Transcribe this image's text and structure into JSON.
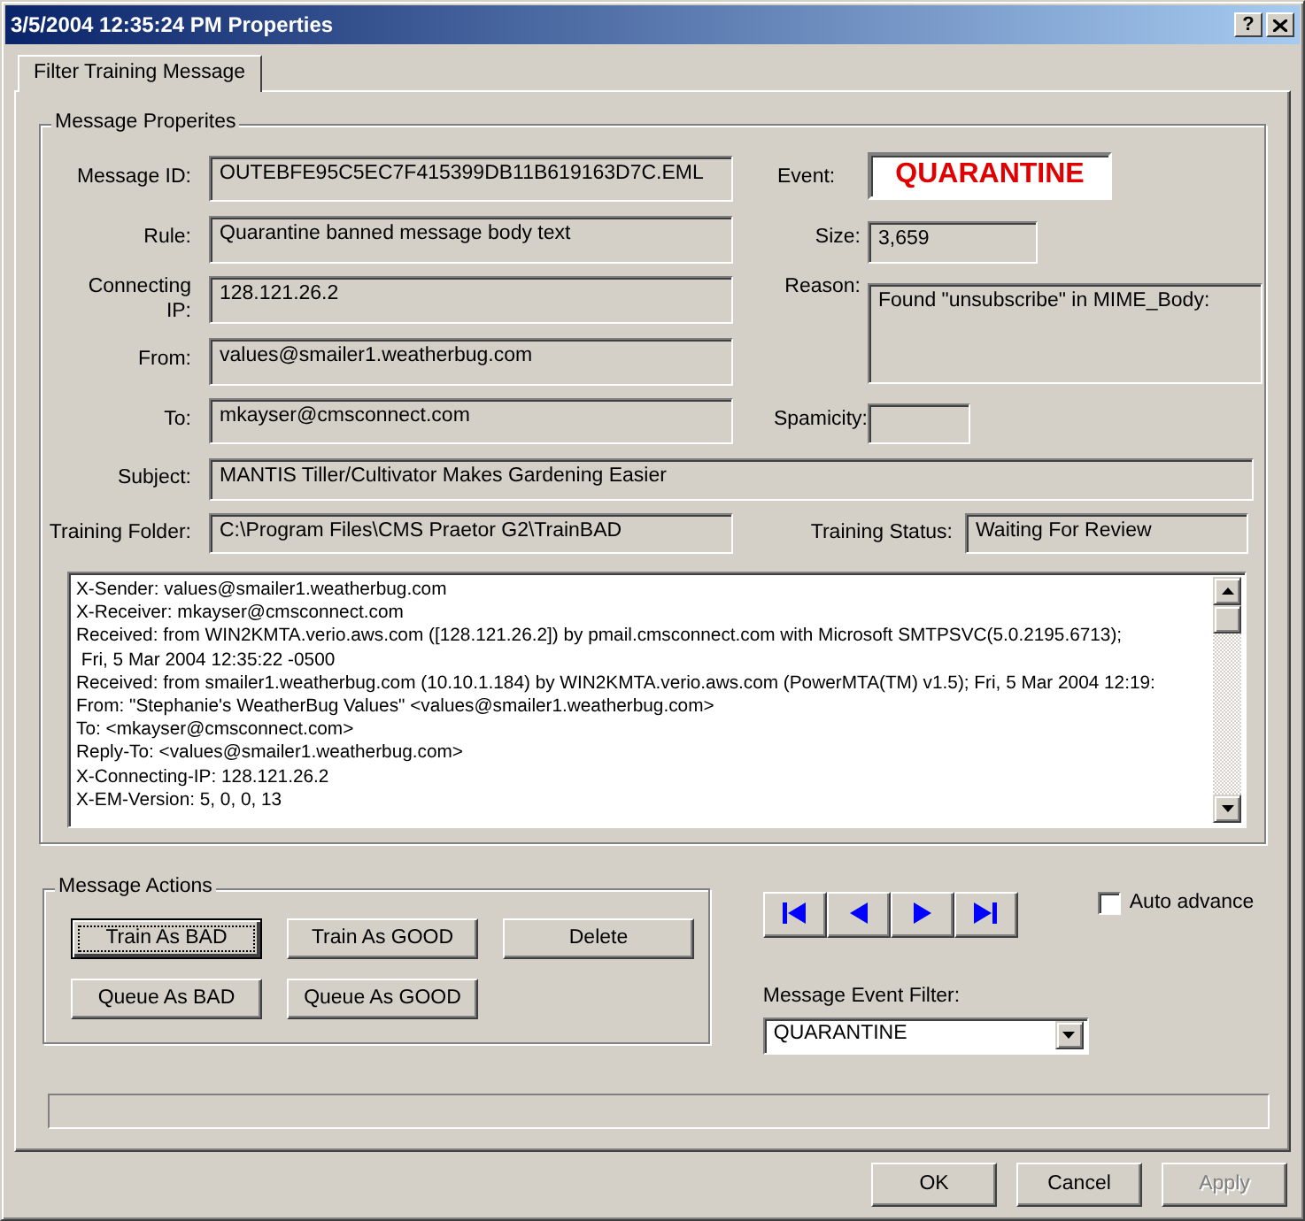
{
  "window": {
    "title": "3/5/2004 12:35:24 PM Properties",
    "help_label": "?"
  },
  "tabs": [
    {
      "label": "Filter Training Message",
      "selected": true
    }
  ],
  "message_properties": {
    "title": "Message Properites",
    "message_id": {
      "label": "Message ID:",
      "value": "OUTEBFE95C5EC7F415399DB11B619163D7C.EML"
    },
    "rule": {
      "label": "Rule:",
      "value": "Quarantine banned message body text"
    },
    "connecting_ip": {
      "label": "Connecting IP:",
      "value": "128.121.26.2"
    },
    "from": {
      "label": "From:",
      "value": "values@smailer1.weatherbug.com"
    },
    "to": {
      "label": "To:",
      "value": "mkayser@cmsconnect.com"
    },
    "subject": {
      "label": "Subject:",
      "value": "MANTIS Tiller/Cultivator Makes Gardening Easier"
    },
    "training_folder": {
      "label": "Training Folder:",
      "value": "C:\\Program Files\\CMS Praetor G2\\TrainBAD"
    },
    "event": {
      "label": "Event:",
      "value": "QUARANTINE"
    },
    "size": {
      "label": "Size:",
      "value": "3,659"
    },
    "reason": {
      "label": "Reason:",
      "value": "Found \"unsubscribe\" in MIME_Body:"
    },
    "spamicity": {
      "label": "Spamicity:"
    },
    "training_status": {
      "label": "Training Status:",
      "value": "Waiting For Review"
    },
    "headers": [
      "X-Sender: values@smailer1.weatherbug.com",
      "X-Receiver: mkayser@cmsconnect.com",
      "Received: from WIN2KMTA.verio.aws.com ([128.121.26.2]) by pmail.cmsconnect.com with Microsoft SMTPSVC(5.0.2195.6713);",
      " Fri, 5 Mar 2004 12:35:22 -0500",
      "Received: from smailer1.weatherbug.com (10.10.1.184) by WIN2KMTA.verio.aws.com (PowerMTA(TM) v1.5); Fri, 5 Mar 2004 12:19:",
      "From: \"Stephanie's WeatherBug Values\" <values@smailer1.weatherbug.com>",
      "To: <mkayser@cmsconnect.com>",
      "Reply-To: <values@smailer1.weatherbug.com>",
      "X-Connecting-IP: 128.121.26.2",
      "X-EM-Version: 5, 0, 0, 13"
    ]
  },
  "message_actions": {
    "title": "Message Actions",
    "buttons": [
      {
        "label": "Train As BAD",
        "focused": true
      },
      {
        "label": "Train As GOOD",
        "focused": false
      },
      {
        "label": "Delete",
        "focused": false
      },
      {
        "label": "Queue As BAD",
        "focused": false
      },
      {
        "label": "Queue As GOOD",
        "focused": false
      }
    ]
  },
  "auto_advance": {
    "label": "Auto advance",
    "checked": false
  },
  "event_filter": {
    "label": "Message Event Filter:",
    "value": "QUARANTINE"
  },
  "dialog_buttons": [
    {
      "label": "OK",
      "disabled": false
    },
    {
      "label": "Cancel",
      "disabled": false
    },
    {
      "label": "Apply",
      "disabled": true
    }
  ]
}
